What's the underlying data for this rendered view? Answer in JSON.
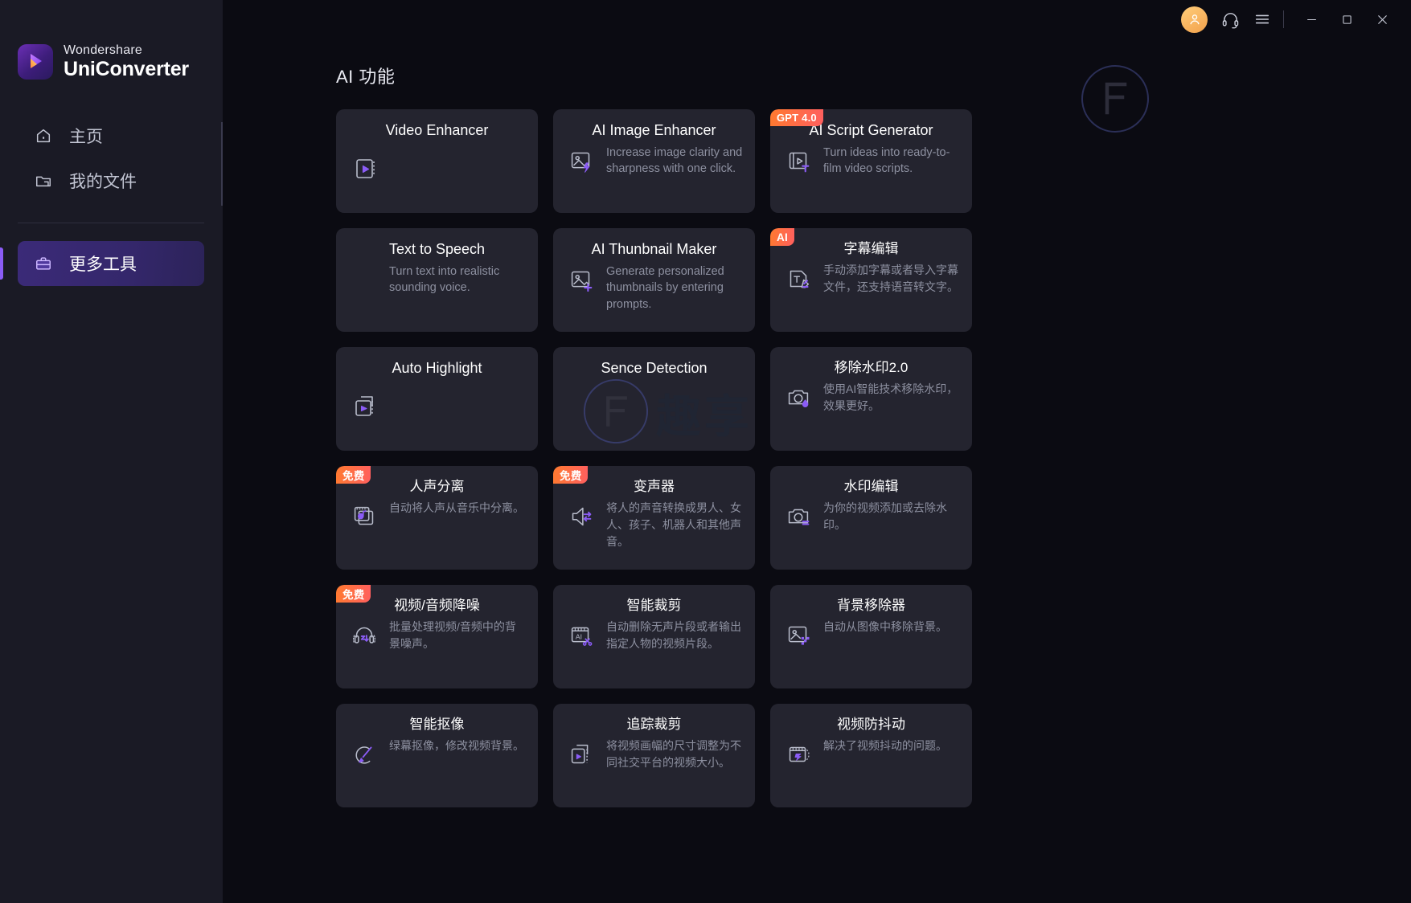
{
  "app": {
    "brand_top": "Wondershare",
    "brand_bottom": "UniConverter",
    "accent": "#8b5cf6",
    "badge_gradient_from": "#ff7a2f",
    "badge_gradient_to": "#ff5f5f",
    "card_bg": "#24242f",
    "sidebar_bg": "#1a1a25",
    "canvas_bg": "#0b0b12"
  },
  "titlebar": {
    "avatar_icon": "user-avatar-icon",
    "support_icon": "headset-icon",
    "menu_icon": "hamburger-menu-icon",
    "minimize_icon": "minimize-icon",
    "maximize_icon": "maximize-icon",
    "close_icon": "close-icon"
  },
  "sidebar": {
    "items": [
      {
        "label": "主页",
        "icon": "home-icon",
        "active": false
      },
      {
        "label": "我的文件",
        "icon": "folder-icon",
        "active": false
      },
      {
        "label": "更多工具",
        "icon": "toolbox-icon",
        "active": true
      }
    ]
  },
  "main": {
    "section_title": "AI 功能",
    "cards": [
      {
        "title": "Video Enhancer",
        "desc": "",
        "badge": "",
        "icon": "video-enhance-icon"
      },
      {
        "title": "AI Image Enhancer",
        "desc": "Increase image clarity and sharpness with one click.",
        "badge": "",
        "icon": "image-enhance-icon"
      },
      {
        "title": "AI Script Generator",
        "desc": "Turn ideas into ready-to-film video scripts.",
        "badge": "GPT 4.0",
        "icon": "script-generator-icon"
      },
      {
        "title": "Text to Speech",
        "desc": "Turn text into realistic sounding voice.",
        "badge": "",
        "icon": "text-to-speech-icon"
      },
      {
        "title": "AI Thunbnail Maker",
        "desc": "Generate personalized thumbnails by entering prompts.",
        "badge": "",
        "icon": "thumbnail-maker-icon"
      },
      {
        "title": "字幕编辑",
        "desc": "手动添加字幕或者导入字幕文件，还支持语音转文字。",
        "badge": "AI",
        "icon": "subtitle-edit-icon"
      },
      {
        "title": "Auto Highlight",
        "desc": "",
        "badge": "",
        "icon": "auto-highlight-icon"
      },
      {
        "title": "Sence Detection",
        "desc": "",
        "badge": "",
        "icon": "scene-detection-icon"
      },
      {
        "title": "移除水印2.0",
        "desc": "使用AI智能技术移除水印，效果更好。",
        "badge": "",
        "icon": "watermark-remove-icon"
      },
      {
        "title": "人声分离",
        "desc": "自动将人声从音乐中分离。",
        "badge": "免费",
        "icon": "vocal-remover-icon"
      },
      {
        "title": "变声器",
        "desc": "将人的声音转换成男人、女人、孩子、机器人和其他声音。",
        "badge": "免费",
        "icon": "voice-changer-icon"
      },
      {
        "title": "水印编辑",
        "desc": "为你的视频添加或去除水印。",
        "badge": "",
        "icon": "watermark-edit-icon"
      },
      {
        "title": "视频/音频降噪",
        "desc": "批量处理视频/音频中的背景噪声。",
        "badge": "免费",
        "icon": "noise-reduction-icon"
      },
      {
        "title": "智能裁剪",
        "desc": "自动删除无声片段或者输出指定人物的视频片段。",
        "badge": "",
        "icon": "smart-trim-icon"
      },
      {
        "title": "背景移除器",
        "desc": "自动从图像中移除背景。",
        "badge": "",
        "icon": "background-remove-icon"
      },
      {
        "title": "智能抠像",
        "desc": "绿幕抠像，修改视频背景。",
        "badge": "",
        "icon": "smart-matting-icon"
      },
      {
        "title": "追踪裁剪",
        "desc": "将视频画幅的尺寸调整为不同社交平台的视频大小。",
        "badge": "",
        "icon": "auto-reframe-icon"
      },
      {
        "title": "视频防抖动",
        "desc": "解决了视频抖动的问题。",
        "badge": "",
        "icon": "video-stabilizer-icon"
      }
    ]
  }
}
